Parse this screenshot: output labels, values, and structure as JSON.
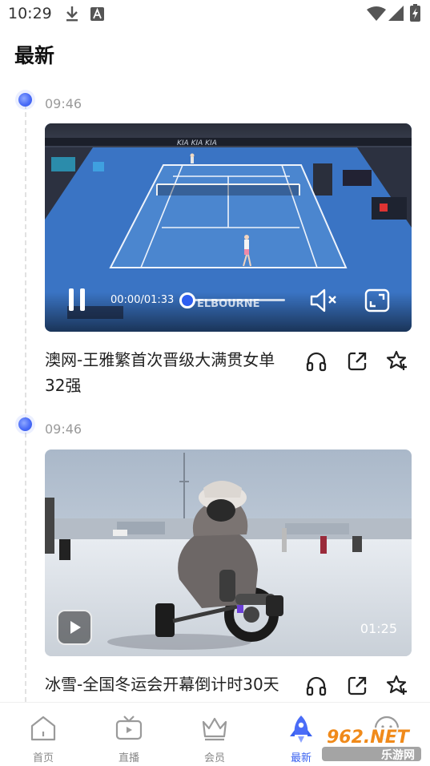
{
  "status_bar": {
    "time": "10:29",
    "icons": [
      "download-icon",
      "notification-a-icon",
      "wifi-icon",
      "signal-icon",
      "battery-charging-icon"
    ]
  },
  "page": {
    "title": "最新"
  },
  "feed": [
    {
      "time": "09:46",
      "video": {
        "state": "playing",
        "position": "00:00/01:33",
        "progress": 0.0,
        "muted": true,
        "scene": "tennis-court"
      },
      "title": "澳网-王雅繁首次晋级大满贯女单32强",
      "actions": [
        "headphones-icon",
        "share-icon",
        "favorite-star-icon"
      ]
    },
    {
      "time": "09:46",
      "video": {
        "state": "paused",
        "duration": "01:25",
        "scene": "snow-go-kart"
      },
      "title": "冰雪-全国冬运会开幕倒计时30天",
      "actions": [
        "headphones-icon",
        "share-icon",
        "favorite-star-icon"
      ]
    }
  ],
  "bottom_nav": {
    "active": "最新",
    "items": [
      {
        "label": "首页",
        "icon": "home-icon"
      },
      {
        "label": "直播",
        "icon": "tv-icon"
      },
      {
        "label": "会员",
        "icon": "crown-icon"
      },
      {
        "label": "最新",
        "icon": "rocket-icon"
      },
      {
        "label": "",
        "icon": "profile-face-icon"
      }
    ]
  },
  "watermark": {
    "brand": "962.NET",
    "subtitle": "乐游网"
  },
  "colors": {
    "accent": "#3a62f0",
    "court": "#3a74c4",
    "timeline_dot": "#4a6cf7"
  }
}
